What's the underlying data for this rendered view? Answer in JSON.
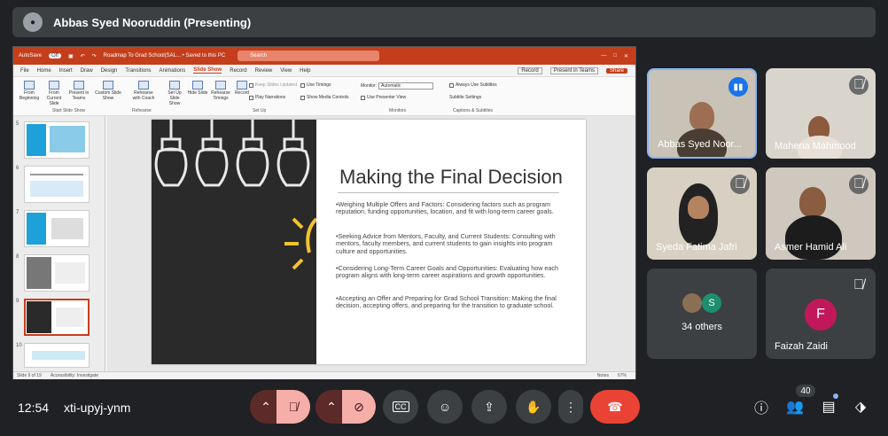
{
  "header": {
    "presenter_title": "Abbas Syed Nooruddin (Presenting)"
  },
  "ppt": {
    "autosave": "AutoSave",
    "autosave_state": "Off",
    "file_title": "Roadmap To Grad School(SAL... • Saved to this PC",
    "search_placeholder": "Search",
    "menu": [
      "File",
      "Home",
      "Insert",
      "Draw",
      "Design",
      "Transitions",
      "Animations",
      "Slide Show",
      "Record",
      "Review",
      "View",
      "Help"
    ],
    "menu_active": "Slide Show",
    "record_btn": "Record",
    "present_teams_btn": "Present in Teams",
    "share_btn": "Share",
    "ribbon": {
      "from_beginning": "From Beginning",
      "from_current": "From Current Slide",
      "present_teams": "Present in Teams",
      "custom_show": "Custom Slide Show",
      "group_start": "Start Slide Show",
      "rehearse_coach": "Rehearse with Coach",
      "group_rehearse": "Rehearse",
      "set_up": "Set Up Slide Show",
      "hide_slide": "Hide Slide",
      "rehearse_timings": "Rehearse Timings",
      "record": "Record",
      "keep_updated": "Keep Slides Updated",
      "play_narrations": "Play Narrations",
      "use_timings": "Use Timings",
      "show_media": "Show Media Controls",
      "group_setup": "Set Up",
      "monitor": "Monitor:",
      "monitor_value": "Automatic",
      "presenter_view": "Use Presenter View",
      "group_monitors": "Monitors",
      "always_subtitles": "Always Use Subtitles",
      "subtitle_settings": "Subtitle Settings",
      "group_captions": "Captions & Subtitles"
    },
    "thumb_numbers": [
      "5",
      "6",
      "7",
      "8",
      "9",
      "10"
    ],
    "status": {
      "slide": "Slide 9 of 19",
      "accessibility": "Accessibility: Investigate",
      "notes": "Notes",
      "zoom": "67%"
    }
  },
  "slide": {
    "title": "Making the Final Decision",
    "bullets": [
      "•Weighing Multiple Offers and Factors: Considering factors such as program reputation, funding opportunities, location, and fit with long-term career goals.",
      "•Seeking Advice from Mentors, Faculty, and Current Students: Consulting with mentors, faculty members, and current students to gain insights into program culture and opportunities.",
      "•Considering Long-Term Career Goals and Opportunities: Evaluating how each program aligns with long-term career aspirations and growth opportunities.",
      "•Accepting an Offer and Preparing for Grad School Transition: Making the final decision, accepting offers, and preparing for the transition to graduate school."
    ]
  },
  "participants": [
    {
      "name": "Abbas Syed Noor..."
    },
    {
      "name": "Mahena Mahmood"
    },
    {
      "name": "Syeda Fatima Jafri"
    },
    {
      "name": "Asmer Hamid Ali"
    },
    {
      "name": "34 others",
      "avatar_letter": "S"
    },
    {
      "name": "Faizah Zaidi",
      "avatar_letter": "F"
    }
  ],
  "bottom": {
    "time": "12:54",
    "meeting_code": "xti-upyj-ynm",
    "people_count": "40"
  },
  "colors": {
    "meet_bg": "#202124",
    "ppt_red": "#c43e1c",
    "end_call": "#ea4335",
    "f_avatar": "#c2185b",
    "s_avatar": "#1e8e6e"
  }
}
